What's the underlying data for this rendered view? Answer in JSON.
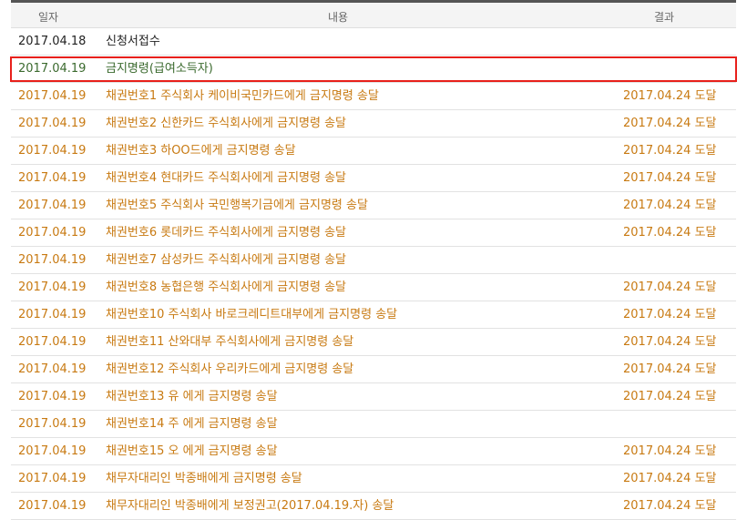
{
  "columns": {
    "date": "일자",
    "content": "내용",
    "result": "결과"
  },
  "rows": [
    {
      "date": "2017.04.18",
      "content": "신청서접수",
      "result": "",
      "tone": "black",
      "highlighted": false
    },
    {
      "date": "2017.04.19",
      "content": "금지명령(급여소득자)",
      "result": "",
      "tone": "green",
      "highlighted": true
    },
    {
      "date": "2017.04.19",
      "content": "채권번호1 주식회사 케이비국민카드에게 금지명령 송달",
      "result": "2017.04.24 도달",
      "tone": "orange",
      "highlighted": false
    },
    {
      "date": "2017.04.19",
      "content": "채권번호2 신한카드 주식회사에게 금지명령 송달",
      "result": "2017.04.24 도달",
      "tone": "orange",
      "highlighted": false
    },
    {
      "date": "2017.04.19",
      "content": "채권번호3 하OO드에게 금지명령 송달",
      "result": "2017.04.24 도달",
      "tone": "orange",
      "highlighted": false
    },
    {
      "date": "2017.04.19",
      "content": "채권번호4 현대카드 주식회사에게 금지명령 송달",
      "result": "2017.04.24 도달",
      "tone": "orange",
      "highlighted": false
    },
    {
      "date": "2017.04.19",
      "content": "채권번호5 주식회사 국민행복기금에게 금지명령 송달",
      "result": "2017.04.24 도달",
      "tone": "orange",
      "highlighted": false
    },
    {
      "date": "2017.04.19",
      "content": "채권번호6 롯데카드 주식회사에게 금지명령 송달",
      "result": "2017.04.24 도달",
      "tone": "orange",
      "highlighted": false
    },
    {
      "date": "2017.04.19",
      "content": "채권번호7 삼성카드 주식회사에게 금지명령 송달",
      "result": "",
      "tone": "orange",
      "highlighted": false
    },
    {
      "date": "2017.04.19",
      "content": "채권번호8 농협은행 주식회사에게 금지명령 송달",
      "result": "2017.04.24 도달",
      "tone": "orange",
      "highlighted": false
    },
    {
      "date": "2017.04.19",
      "content": "채권번호10 주식회사 바로크레디트대부에게 금지명령 송달",
      "result": "2017.04.24 도달",
      "tone": "orange",
      "highlighted": false
    },
    {
      "date": "2017.04.19",
      "content": "채권번호11 산와대부 주식회사에게 금지명령 송달",
      "result": "2017.04.24 도달",
      "tone": "orange",
      "highlighted": false
    },
    {
      "date": "2017.04.19",
      "content": "채권번호12 주식회사 우리카드에게 금지명령 송달",
      "result": "2017.04.24 도달",
      "tone": "orange",
      "highlighted": false
    },
    {
      "date": "2017.04.19",
      "content": "채권번호13 유     에게 금지명령 송달",
      "result": "2017.04.24 도달",
      "tone": "orange",
      "highlighted": false
    },
    {
      "date": "2017.04.19",
      "content": "채권번호14 주     에게 금지명령 송달",
      "result": "",
      "tone": "orange",
      "highlighted": false
    },
    {
      "date": "2017.04.19",
      "content": "채권번호15 오     에게 금지명령 송달",
      "result": "2017.04.24 도달",
      "tone": "orange",
      "highlighted": false
    },
    {
      "date": "2017.04.19",
      "content": "채무자대리인 박종배에게 금지명령 송달",
      "result": "2017.04.24 도달",
      "tone": "orange",
      "highlighted": false
    },
    {
      "date": "2017.04.19",
      "content": "채무자대리인 박종배에게 보정권고(2017.04.19.자) 송달",
      "result": "2017.04.24 도달",
      "tone": "orange",
      "highlighted": false
    }
  ]
}
